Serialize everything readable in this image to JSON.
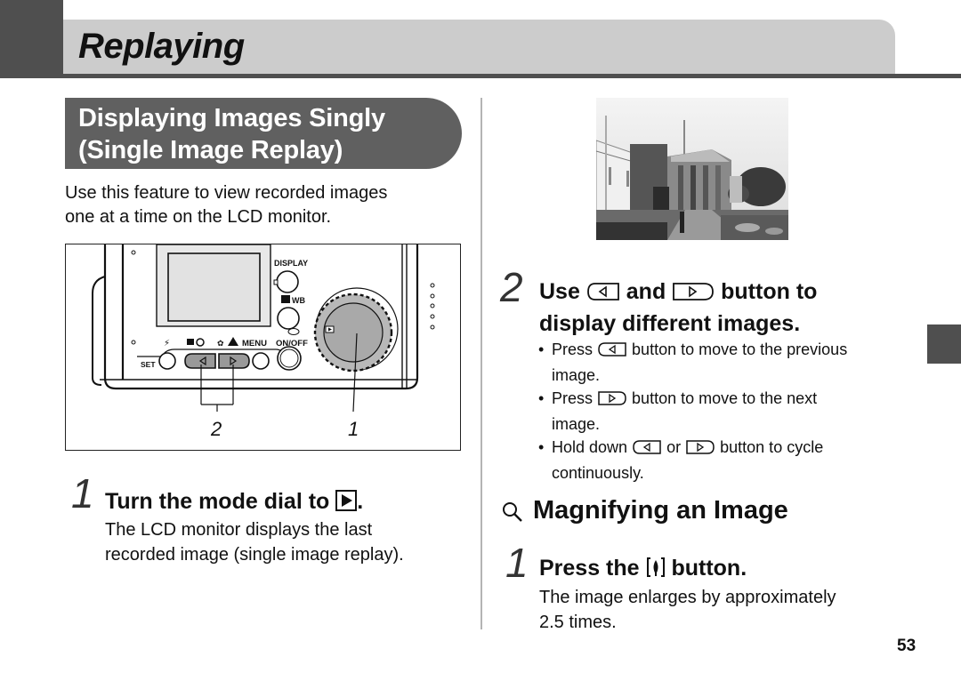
{
  "header": {
    "title": "Replaying"
  },
  "section": {
    "title_line1": "Displaying Images Singly",
    "title_line2": "(Single Image Replay)",
    "intro_line1": "Use this feature to view recorded images",
    "intro_line2": "one at a time on the LCD monitor."
  },
  "illustration": {
    "labels": {
      "display": "DISPLAY",
      "wb": "WB",
      "menu": "MENU",
      "on_off": "ON/OFF",
      "set": "SET"
    },
    "callouts": {
      "left": "2",
      "right": "1"
    }
  },
  "steps_left": [
    {
      "number": "1",
      "title_prefix": "Turn the mode dial to",
      "title_suffix": ".",
      "title_icon": "play-mode-icon",
      "body_line1": "The LCD monitor displays the last",
      "body_line2": "recorded image (single image replay)."
    }
  ],
  "steps_right": [
    {
      "number": "2",
      "title_part1": "Use",
      "title_part2": "and",
      "title_part3": "button to",
      "title_line2": "display different images.",
      "bullets": [
        {
          "before": "Press",
          "icon": "left-arrow-button-icon",
          "after": "button to move to the previous",
          "cont": "image."
        },
        {
          "before": "Press",
          "icon": "right-arrow-button-icon",
          "after": "button to move to the next",
          "cont": "image."
        },
        {
          "before": "Hold down",
          "icon": "left-arrow-button-icon",
          "mid": "or",
          "icon2": "right-arrow-button-icon",
          "after": "button to cycle",
          "cont": "continuously."
        }
      ]
    }
  ],
  "magnify": {
    "icon": "magnifier-icon",
    "title": "Magnifying an Image",
    "step": {
      "number": "1",
      "title_prefix": "Press the",
      "title_icon": "zoom-tele-button-icon",
      "title_suffix": "button.",
      "body_line1": "The image enlarges by approximately",
      "body_line2": "2.5 times."
    }
  },
  "page_number": "53",
  "colors": {
    "header_dark": "#4f4f4f",
    "header_band": "#cccccc",
    "section_box": "#606060",
    "divider": "#b4b4b4"
  }
}
